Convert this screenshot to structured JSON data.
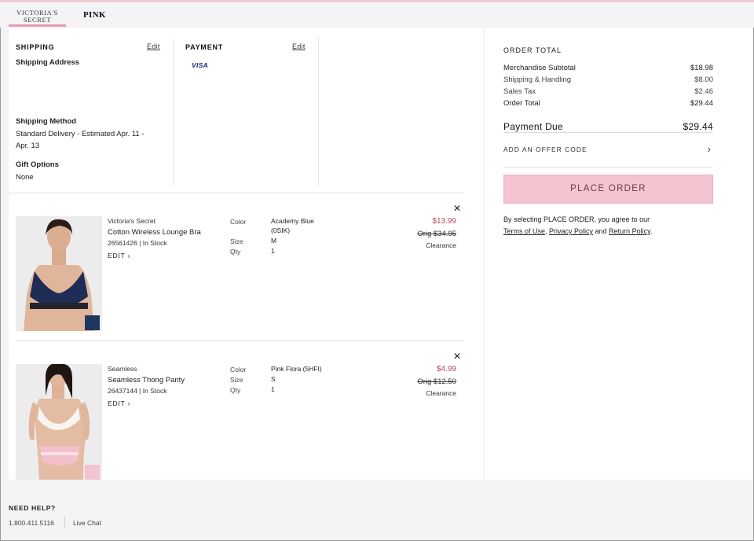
{
  "header": {
    "brand_vs_line1": "VICTORIA'S",
    "brand_vs_line2": "SECRET",
    "brand_pink": "PINK"
  },
  "shipping": {
    "label": "SHIPPING",
    "edit": "Edit",
    "address_label": "Shipping Address",
    "method_label": "Shipping Method",
    "method_line1": "Standard Delivery - Estimated Apr. 11 -",
    "method_line2": "Apr. 13",
    "gift_label": "Gift Options",
    "gift_value": "None"
  },
  "payment": {
    "label": "PAYMENT",
    "edit": "Edit",
    "card_brand": "VISA"
  },
  "items": [
    {
      "brand": "Victoria's Secret",
      "name": "Cotton Wireless Lounge Bra",
      "sku_stock": "26561426 | In Stock",
      "edit": "EDIT",
      "color_label": "Color",
      "color_value_line1": "Academy Blue",
      "color_value_line2": "(0SIK)",
      "size_label": "Size",
      "size_value": "M",
      "qty_label": "Qty",
      "qty_value": "1",
      "price": "$13.99",
      "orig": "Orig $34.95",
      "tag": "Clearance",
      "swatch_color": "#1f3760"
    },
    {
      "brand": "Seamless",
      "name": "Seamless Thong Panty",
      "sku_stock": "26437144 | In Stock",
      "edit": "EDIT",
      "color_label": "Color",
      "color_value_line1": "Pink Flora (5HFI)",
      "color_value_line2": "",
      "size_label": "Size",
      "size_value": "S",
      "qty_label": "Qty",
      "qty_value": "1",
      "price": "$4.99",
      "orig": "Orig $12.50",
      "tag": "Clearance",
      "swatch_color": "#f3c3cf"
    }
  ],
  "order_total": {
    "title": "ORDER TOTAL",
    "rows": [
      {
        "label": "Merchandise Subtotal",
        "amount": "$18.98"
      },
      {
        "label": "Shipping & Handling",
        "amount": "$8.00"
      },
      {
        "label": "Sales Tax",
        "amount": "$2.46"
      },
      {
        "label": "Order Total",
        "amount": "$29.44"
      }
    ],
    "payment_due_label": "Payment Due",
    "payment_due_amount": "$29.44",
    "offer_code": "ADD AN OFFER CODE",
    "place_order": "PLACE ORDER",
    "legal_prefix": "By selecting PLACE ORDER, you agree to our",
    "terms": "Terms of Use",
    "comma": ",",
    "privacy": "Privacy Policy",
    "and": "and",
    "return_policy": "Return Policy",
    "period": "."
  },
  "footer": {
    "need_help": "NEED HELP?",
    "phone": "1.800.411.5116",
    "live_chat": "Live Chat"
  },
  "colors": {
    "accent_pink": "#f4c5d0",
    "price_red": "#b04a64",
    "brand_underline": "#e89aaf"
  }
}
